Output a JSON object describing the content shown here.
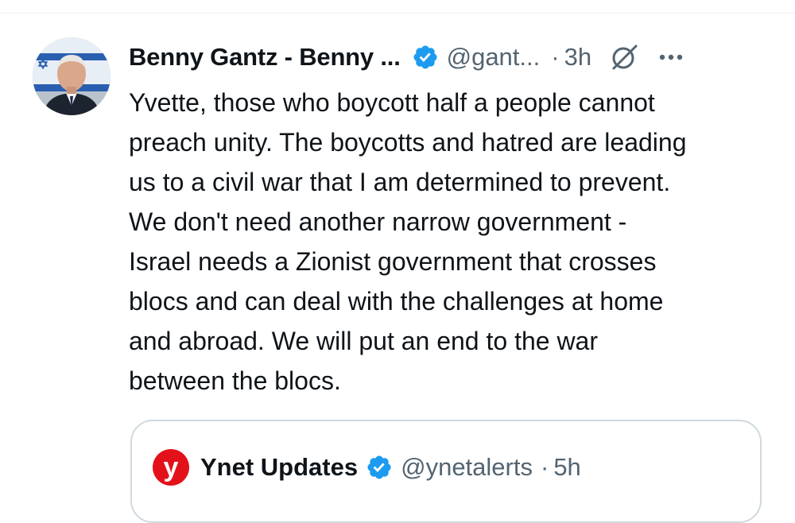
{
  "colors": {
    "verified_badge": "#1d9bf0",
    "secondary_text": "#536471",
    "primary_text": "#0f1419",
    "ynet_red": "#e3121a"
  },
  "tweet": {
    "author_name": "Benny Gantz - Benny ...",
    "handle": "@gant...",
    "separator": "·",
    "time": "3h",
    "text": "Yvette, those who boycott half a people cannot\npreach unity. The boycotts and hatred are leading\nus to a civil war that I am determined to prevent.\nWe don't need another narrow government -\nIsrael needs a Zionist government that crosses\nblocs and can deal with the challenges at home\nand abroad. We will put an end to the war\nbetween the blocs.",
    "icons": [
      "verified-badge-icon",
      "grok-icon",
      "more-options-icon"
    ]
  },
  "quoted_tweet": {
    "avatar_letter": "y",
    "author_name": "Ynet Updates",
    "handle": "@ynetalerts",
    "separator": "·",
    "time": "5h"
  }
}
